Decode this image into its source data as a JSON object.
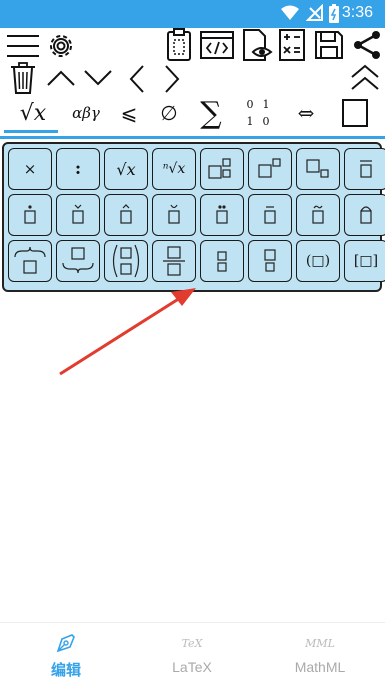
{
  "status_bar": {
    "time": "3:36"
  },
  "tabs": {
    "sqrt_label": "√x",
    "greek_label": "αβγ",
    "leq_label": "⩽",
    "emptyset_label": "∅",
    "sum_label": "∑",
    "matrix": [
      "0",
      "1",
      "1",
      "0"
    ],
    "arrow_label": "⇔"
  },
  "palette": {
    "row1": [
      {
        "name": "times-key",
        "label": "×"
      },
      {
        "name": "colon-key",
        "label": ":"
      },
      {
        "name": "sqrt-key",
        "label": "√x"
      },
      {
        "name": "nth-root-key",
        "label": "ⁿ√x"
      }
    ],
    "row3_paren_key": "(□)",
    "row3_bracket_key": "[□]"
  },
  "bottom_nav": {
    "items": [
      {
        "label": "编辑",
        "active": true
      },
      {
        "label": "LaTeX",
        "active": false
      },
      {
        "label": "MathML",
        "active": false
      }
    ],
    "tex_icon_text": "TeX",
    "mml_icon_text": "MML"
  },
  "colors": {
    "accent": "#36a3e8",
    "palette_bg": "#bfe3f3",
    "annotation_arrow": "#e23b30"
  }
}
